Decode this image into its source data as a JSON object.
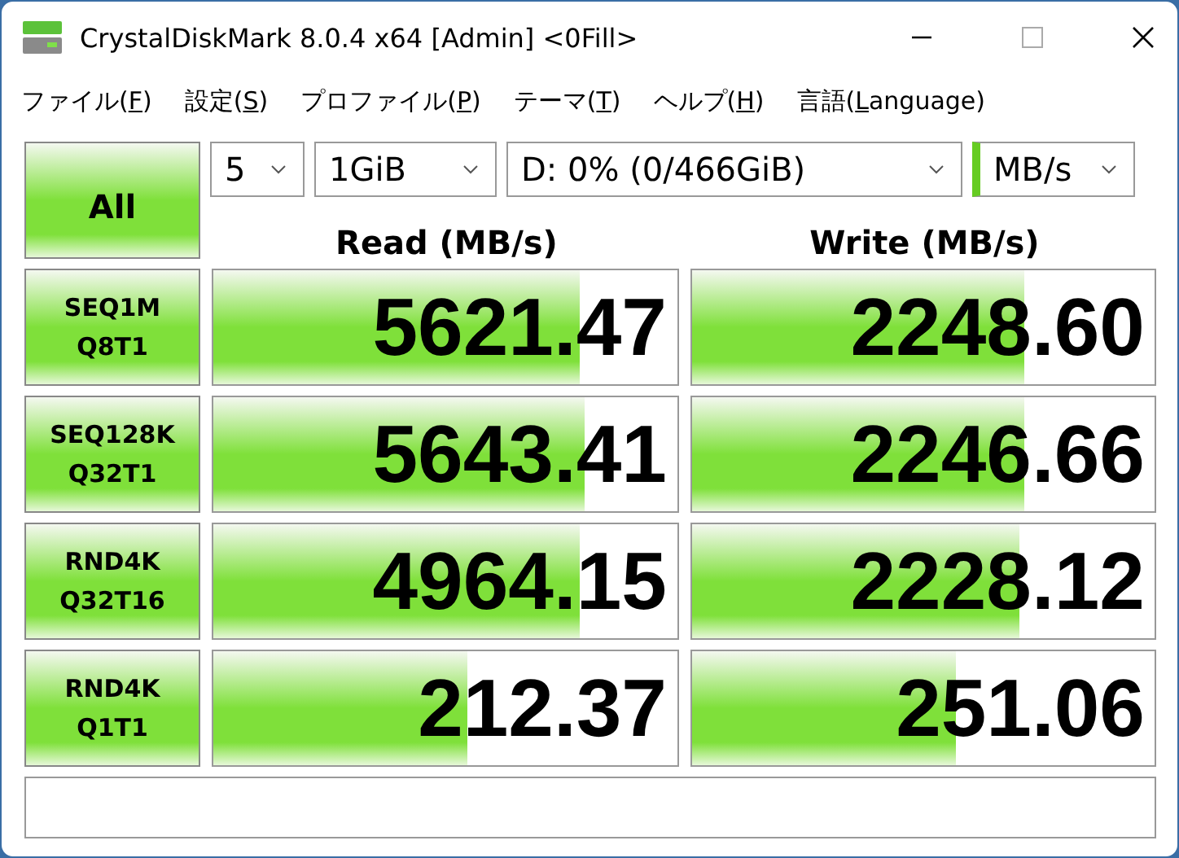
{
  "window": {
    "title": "CrystalDiskMark 8.0.4 x64 [Admin] <0Fill>"
  },
  "menu": [
    {
      "before": "ファイル(",
      "key": "F",
      "after": ")"
    },
    {
      "before": "設定(",
      "key": "S",
      "after": ")"
    },
    {
      "before": "プロファイル(",
      "key": "P",
      "after": ")"
    },
    {
      "before": "テーマ(",
      "key": "T",
      "after": ")"
    },
    {
      "before": "ヘルプ(",
      "key": "H",
      "after": ")"
    },
    {
      "before": "言語(",
      "key": "L",
      "after": "anguage)"
    }
  ],
  "all_button": "All",
  "selectors": {
    "count": "5",
    "size": "1GiB",
    "drive": "D: 0% (0/466GiB)",
    "unit": "MB/s"
  },
  "headers": {
    "read": "Read (MB/s)",
    "write": "Write (MB/s)"
  },
  "rows": [
    {
      "test": "SEQ1M",
      "params": "Q8T1",
      "results": [
        {
          "value": "5621.47",
          "level": 0.79
        },
        {
          "value": "2248.60",
          "level": 0.72
        }
      ]
    },
    {
      "test": "SEQ128K",
      "params": "Q32T1",
      "results": [
        {
          "value": "5643.41",
          "level": 0.8
        },
        {
          "value": "2246.66",
          "level": 0.72
        }
      ]
    },
    {
      "test": "RND4K",
      "params": "Q32T16",
      "results": [
        {
          "value": "4964.15",
          "level": 0.79
        },
        {
          "value": "2228.12",
          "level": 0.71
        }
      ]
    },
    {
      "test": "RND4K",
      "params": "Q1T1",
      "results": [
        {
          "value": "212.37",
          "level": 0.55
        },
        {
          "value": "251.06",
          "level": 0.57
        }
      ]
    }
  ]
}
